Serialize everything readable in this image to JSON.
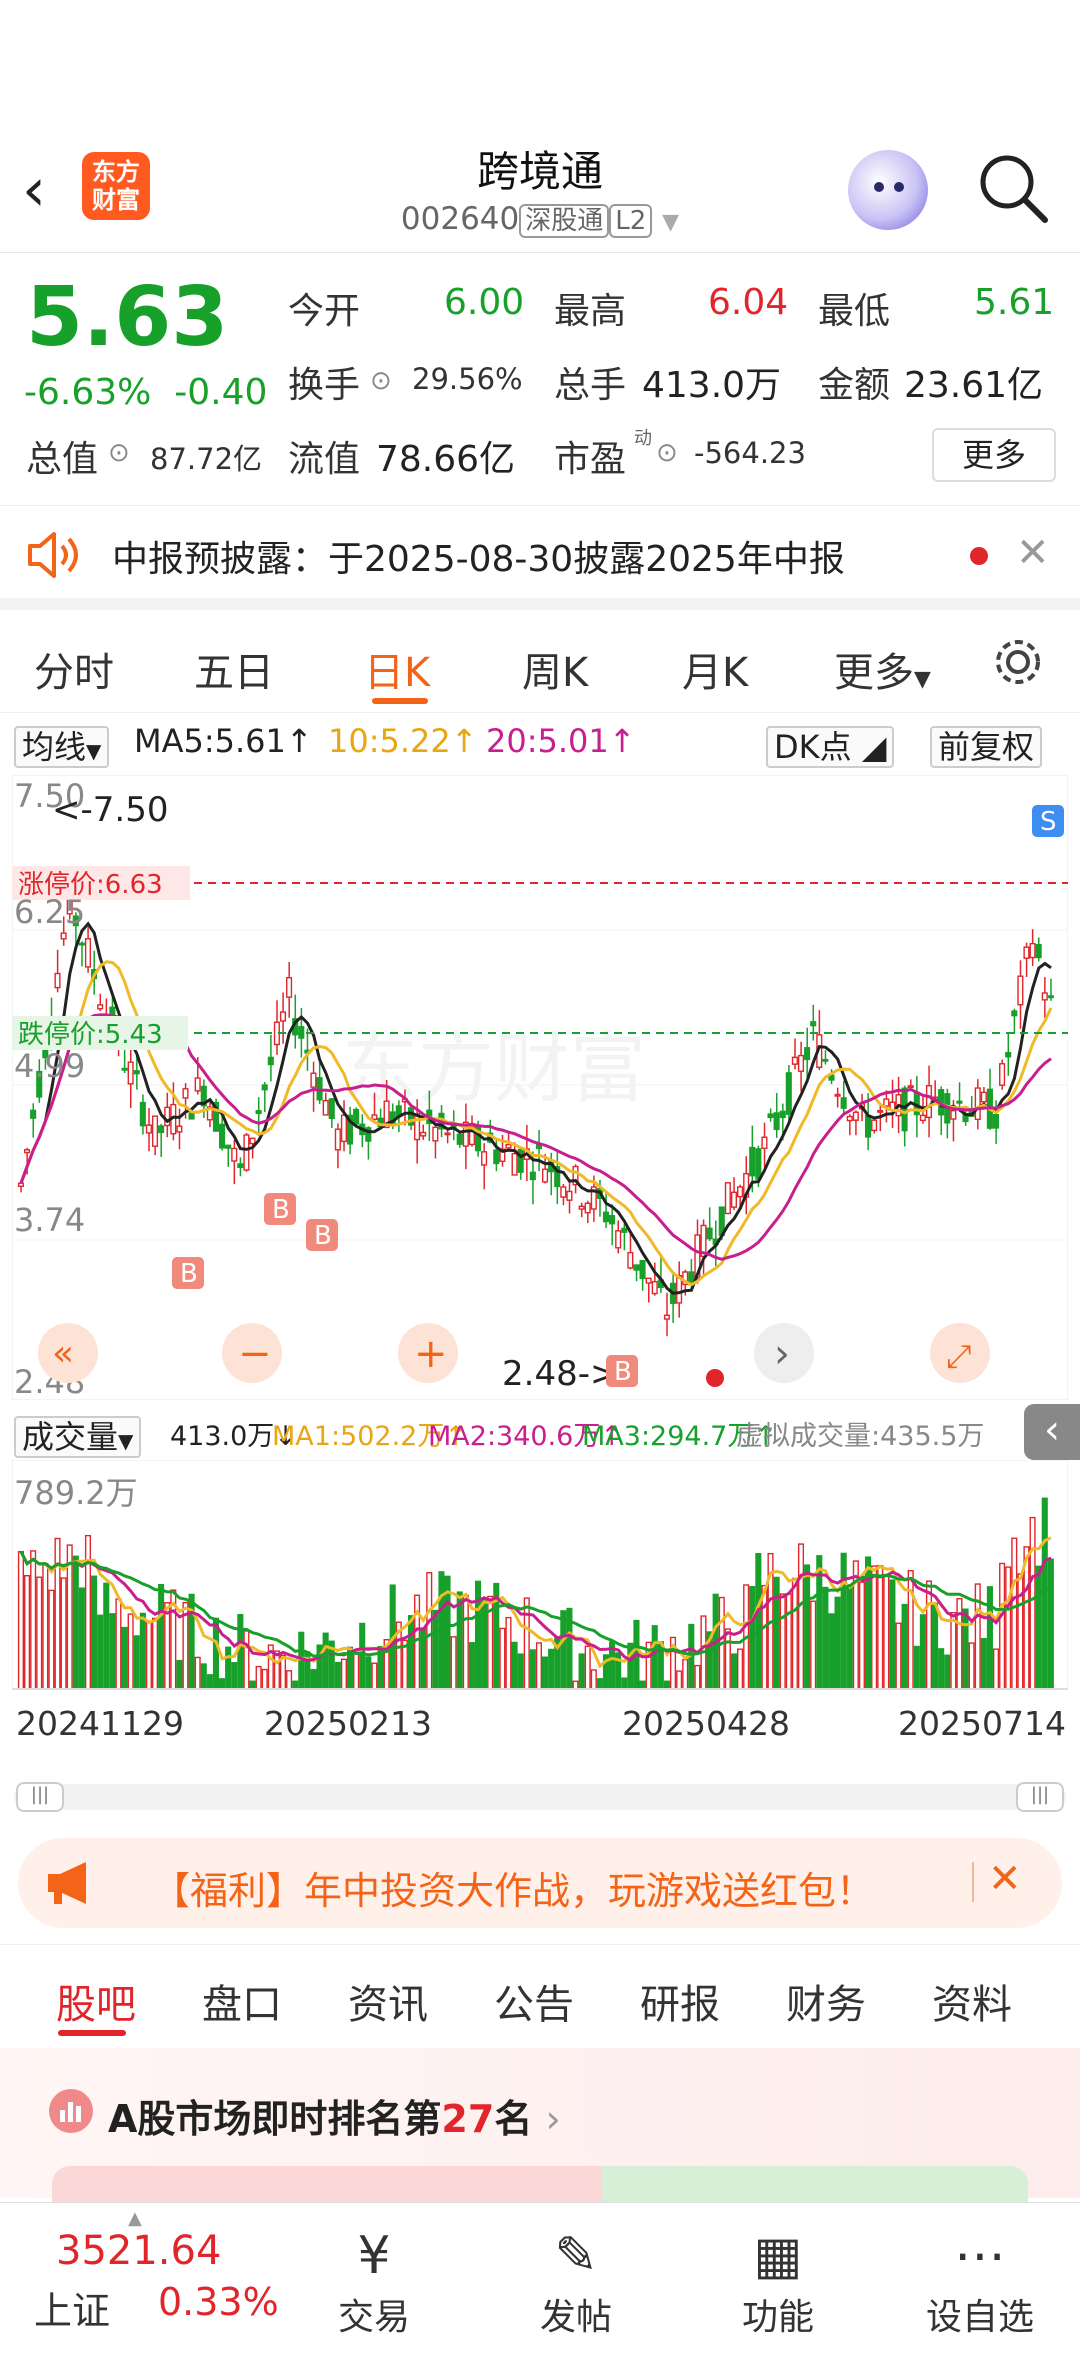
{
  "header": {
    "title": "跨境通",
    "code": "002640",
    "market_tag": "深股通",
    "level_tag": "L2",
    "logo_text_1": "东方",
    "logo_text_2": "财富"
  },
  "quote": {
    "price": "5.63",
    "change_pct": "-6.63%",
    "change_abs": "-0.40",
    "open_label": "今开",
    "open": "6.00",
    "high_label": "最高",
    "high": "6.04",
    "low_label": "最低",
    "low": "5.61",
    "turnover_label": "换手",
    "turnover": "29.56%",
    "volume_label": "总手",
    "volume": "413.0万",
    "amount_label": "金额",
    "amount": "23.61亿",
    "total_cap_label": "总值",
    "total_cap": "87.72亿",
    "float_cap_label": "流值",
    "float_cap": "78.66亿",
    "pe_label": "市盈",
    "pe_sup": "动",
    "pe": "-564.23",
    "more": "更多",
    "colors": {
      "up": "#e0262b",
      "down": "#17a02a"
    }
  },
  "notice": {
    "text": "中报预披露：于2025-08-30披露2025年中报"
  },
  "tabs": [
    "分时",
    "五日",
    "日K",
    "周K",
    "月K",
    "更多"
  ],
  "active_tab": "日K",
  "ma_bar": {
    "selector": "均线",
    "ma5": "MA5:5.61",
    "ma10": "10:5.22",
    "ma20": "20:5.01",
    "dk": "DK点",
    "adjust": "前复权"
  },
  "chart_labels": {
    "y_top": "7.50",
    "y_mid1": "6.25",
    "y_mid2": "4.99",
    "y_mid3": "3.74",
    "y_bottom": "2.48",
    "max_marker": "<-7.50",
    "min_marker": "2.48->",
    "limit_up": "涨停价:6.63",
    "limit_down": "跌停价:5.43",
    "watermark": "东方财富",
    "b_marker": "B",
    "s_marker": "S"
  },
  "volume_bar": {
    "selector": "成交量",
    "vol": "413.0万",
    "ma1": "MA1:502.2万",
    "ma2": "MA2:340.6万",
    "ma3": "MA3:294.7万",
    "virtual": "虚拟成交量:435.5万",
    "y_top": "789.2万"
  },
  "dates": [
    "20241129",
    "20250213",
    "20250428",
    "20250714"
  ],
  "promo": {
    "text": "【福利】年中投资大作战，玩游戏送红包！"
  },
  "bottom_tabs": [
    "股吧",
    "盘口",
    "资讯",
    "公告",
    "研报",
    "财务",
    "资料"
  ],
  "rank": {
    "prefix": "A股市场即时排名第",
    "num": "27",
    "suffix": "名"
  },
  "bottom_nav": {
    "index_value": "3521.64",
    "index_name": "上证",
    "index_change": "0.33%",
    "items": [
      "交易",
      "发帖",
      "功能",
      "设自选"
    ]
  }
}
